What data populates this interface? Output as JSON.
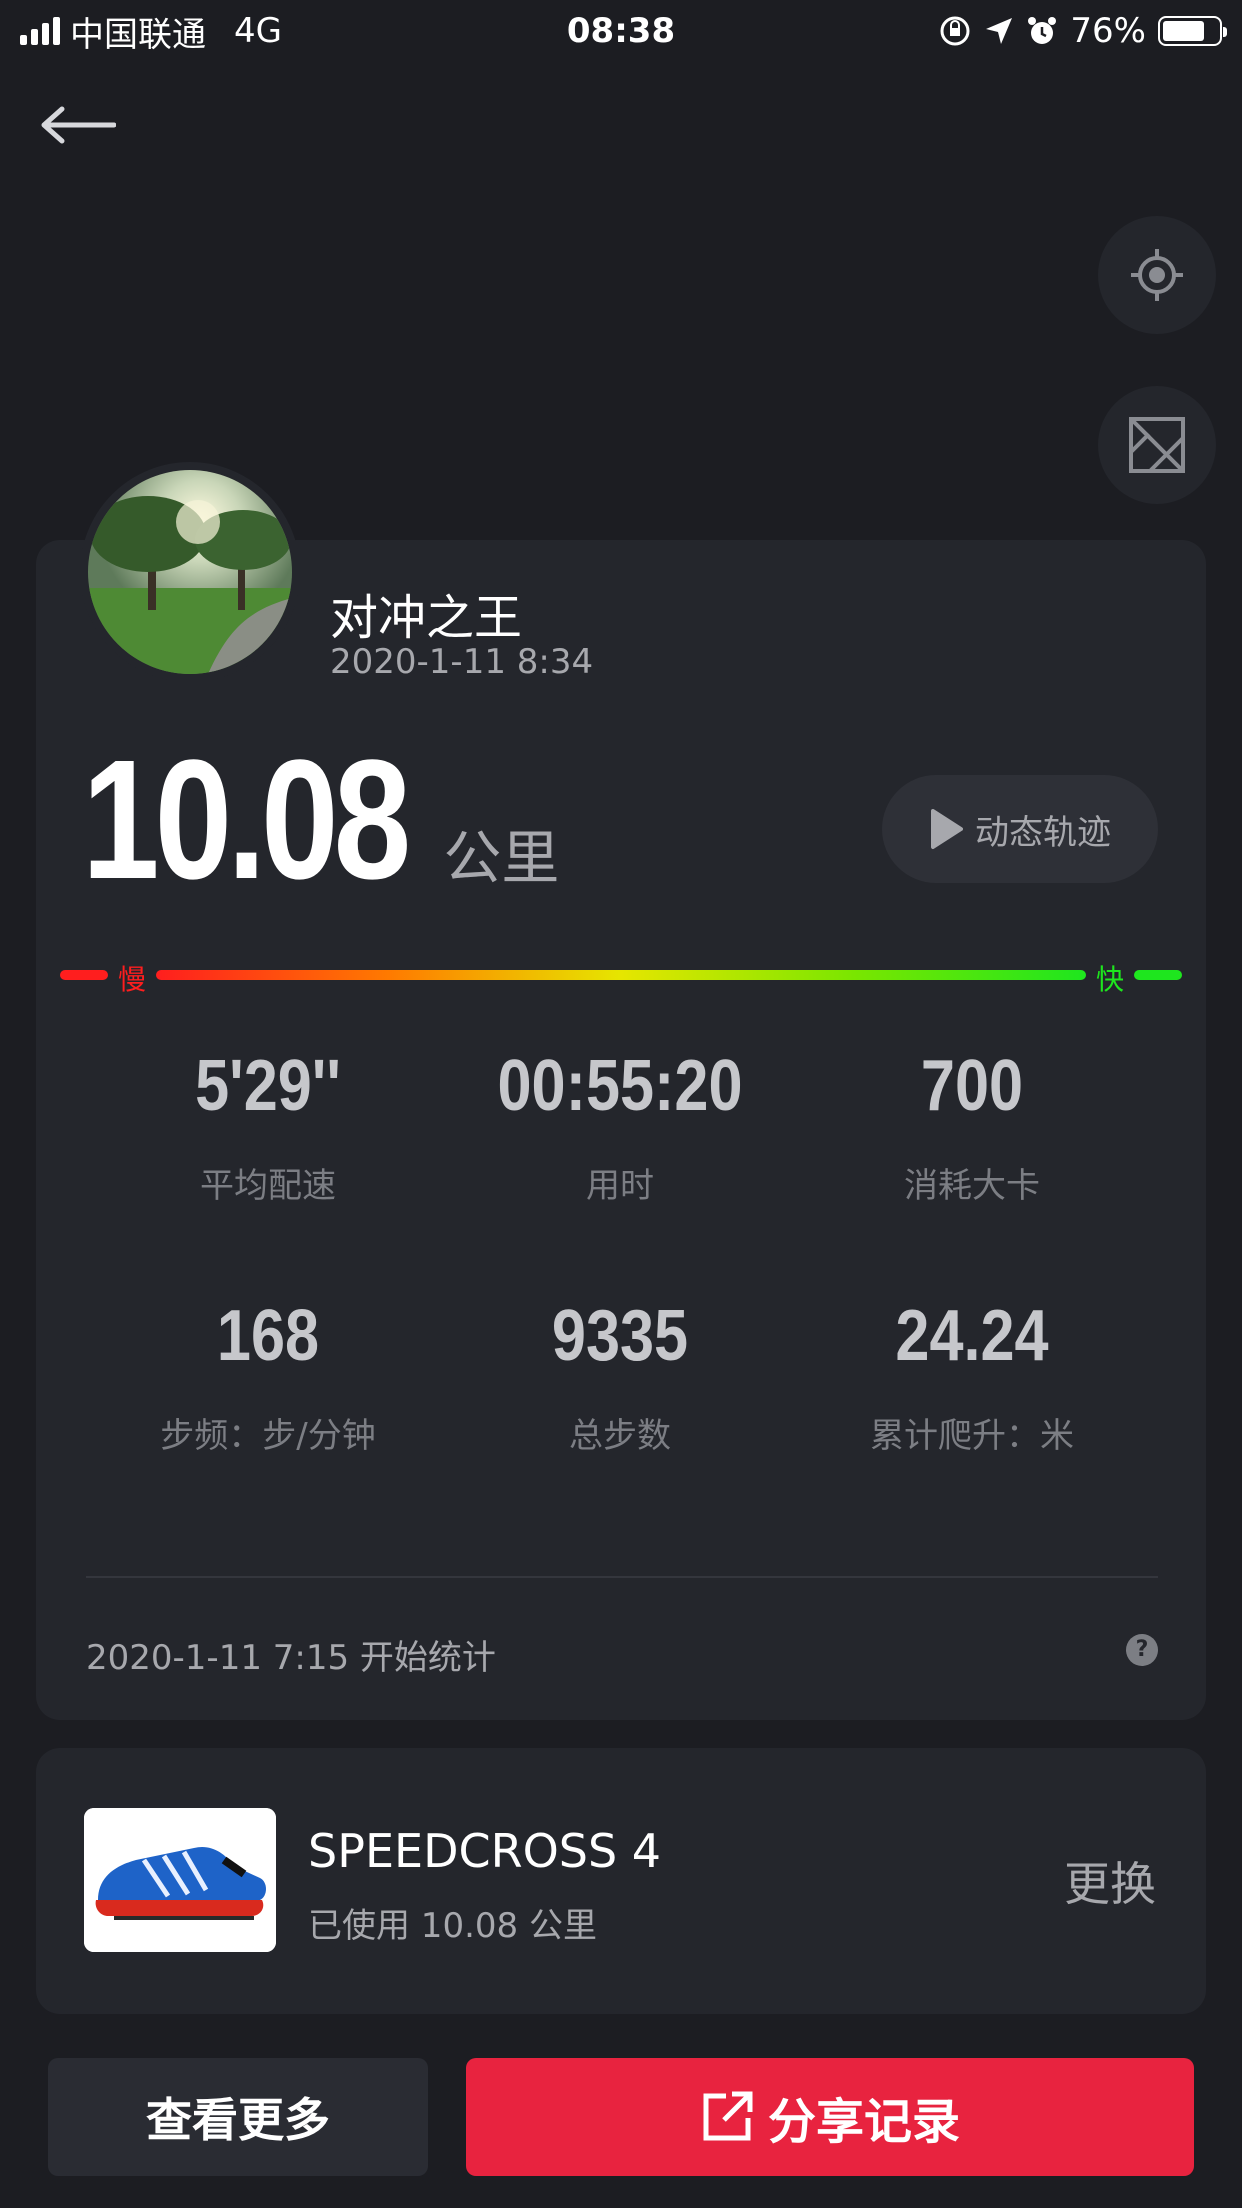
{
  "status_bar": {
    "carrier": "中国联通",
    "network": "4G",
    "time": "08:38",
    "battery": "76%",
    "battery_level": 0.76
  },
  "profile": {
    "name": "对冲之王",
    "datetime": "2020-1-11 8:34"
  },
  "distance": {
    "value": "10.08",
    "unit": "公里"
  },
  "track_button": "动态轨迹",
  "pace_bar": {
    "slow": "慢",
    "fast": "快"
  },
  "stats": [
    {
      "value": "5'29''",
      "label": "平均配速"
    },
    {
      "value": "00:55:20",
      "label": "用时"
    },
    {
      "value": "700",
      "label": "消耗大卡"
    },
    {
      "value": "168",
      "label": "步频：步/分钟"
    },
    {
      "value": "9335",
      "label": "总步数"
    },
    {
      "value": "24.24",
      "label": "累计爬升：米"
    }
  ],
  "start_text": "2020-1-11 7:15 开始统计",
  "help": "?",
  "shoe": {
    "name": "SPEEDCROSS 4",
    "used": "已使用 10.08 公里",
    "change": "更换"
  },
  "buttons": {
    "more": "查看更多",
    "share": "分享记录"
  },
  "colors": {
    "background": "#1c1d22",
    "card": "#24262c",
    "accent_red": "#e8233f",
    "slow": "#ff1e1e",
    "fast": "#1ee61e"
  }
}
